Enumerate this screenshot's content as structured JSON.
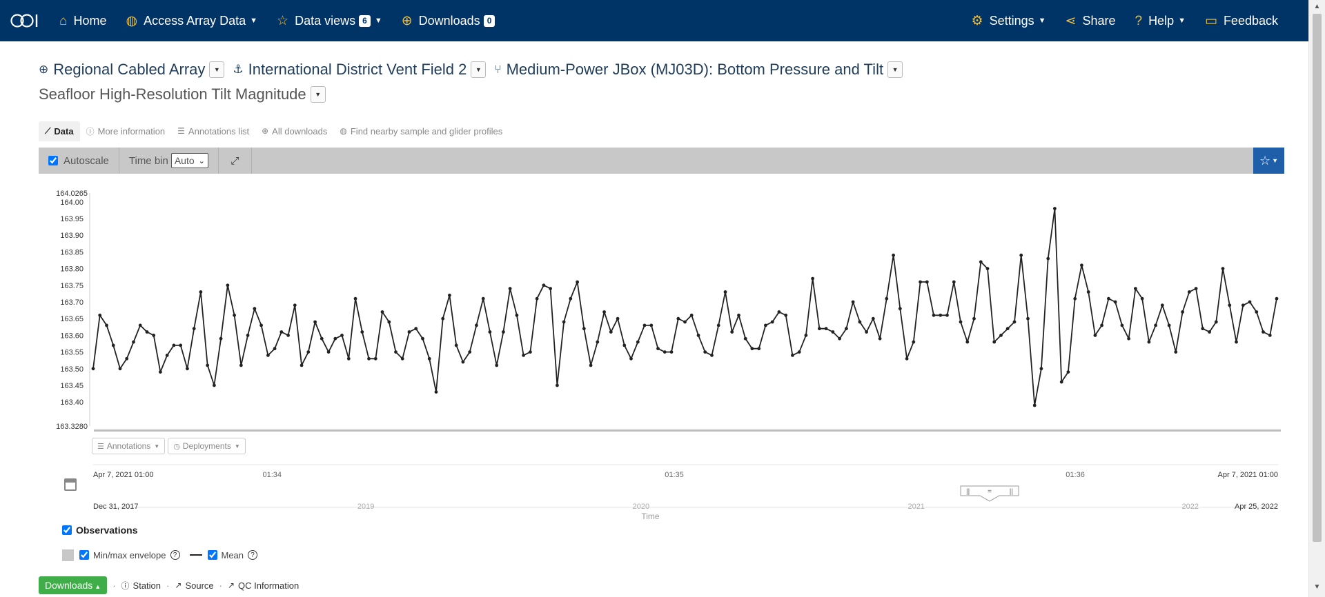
{
  "nav": {
    "home": "Home",
    "access": "Access Array Data",
    "views": "Data views",
    "views_count": "6",
    "downloads": "Downloads",
    "downloads_count": "0",
    "settings": "Settings",
    "share": "Share",
    "help": "Help",
    "feedback": "Feedback"
  },
  "crumbs": {
    "array": "Regional Cabled Array",
    "site": "International District Vent Field 2",
    "node": "Medium-Power JBox (MJ03D): Bottom Pressure and Tilt",
    "instrument": "Seafloor High-Resolution Tilt Magnitude"
  },
  "tabs": {
    "data": "Data",
    "more_info": "More information",
    "annotations": "Annotations list",
    "all_downloads": "All downloads",
    "nearby": "Find nearby sample and glider profiles"
  },
  "toolbar": {
    "autoscale": "Autoscale",
    "time_bin": "Time bin",
    "time_bin_value": "Auto"
  },
  "chips": {
    "annotations": "Annotations",
    "deployments": "Deployments"
  },
  "legend": {
    "observations": "Observations",
    "envelope": "Min/max envelope",
    "mean": "Mean"
  },
  "bottom": {
    "downloads": "Downloads",
    "station": "Station",
    "source": "Source",
    "qc": "QC Information"
  },
  "colors": {
    "navbar": "#003366",
    "nav_icon": "#f0c040",
    "series": "#222222",
    "downloads_button": "#3fae49",
    "fav_button": "#1f5ea8"
  },
  "chart_data": {
    "type": "line",
    "xlabel": "Time",
    "ylim": [
      163.328,
      164.0265
    ],
    "y_ticks": [
      "164.00",
      "163.95",
      "163.90",
      "163.85",
      "163.80",
      "163.75",
      "163.70",
      "163.65",
      "163.60",
      "163.55",
      "163.50",
      "163.45",
      "163.40"
    ],
    "y_extents": [
      "164.0265",
      "163.3280"
    ],
    "x_range_labels": [
      "Apr 7, 2021 01:00",
      "Apr 7, 2021 01:00"
    ],
    "x_ticks": [
      "01:34",
      "01:35",
      "01:36"
    ],
    "navigator_range_labels": [
      "Dec 31, 2017",
      "Apr 25, 2022"
    ],
    "navigator_ticks": [
      "2019",
      "2020",
      "2021",
      "2022"
    ],
    "series": [
      {
        "values": [
          163.5,
          163.66,
          163.63,
          163.57,
          163.5,
          163.53,
          163.58,
          163.63,
          163.61,
          163.6,
          163.49,
          163.54,
          163.57,
          163.57,
          163.5,
          163.62,
          163.73,
          163.51,
          163.45,
          163.59,
          163.75,
          163.66,
          163.51,
          163.6,
          163.68,
          163.63,
          163.54,
          163.56,
          163.61,
          163.6,
          163.69,
          163.51,
          163.55,
          163.64,
          163.59,
          163.55,
          163.59,
          163.6,
          163.53,
          163.71,
          163.61,
          163.53,
          163.53,
          163.67,
          163.64,
          163.55,
          163.53,
          163.61,
          163.62,
          163.59,
          163.53,
          163.43,
          163.65,
          163.72,
          163.57,
          163.52,
          163.55,
          163.63,
          163.71,
          163.61,
          163.51,
          163.61,
          163.74,
          163.66,
          163.54,
          163.55,
          163.71,
          163.75,
          163.74,
          163.45,
          163.64,
          163.71,
          163.76,
          163.62,
          163.51,
          163.58,
          163.67,
          163.61,
          163.65,
          163.57,
          163.53,
          163.58,
          163.63,
          163.63,
          163.56,
          163.55,
          163.55,
          163.65,
          163.64,
          163.66,
          163.6,
          163.55,
          163.54,
          163.63,
          163.73,
          163.61,
          163.66,
          163.59,
          163.56,
          163.56,
          163.63,
          163.64,
          163.67,
          163.66,
          163.54,
          163.55,
          163.6,
          163.77,
          163.62,
          163.62,
          163.61,
          163.59,
          163.62,
          163.7,
          163.64,
          163.61,
          163.65,
          163.59,
          163.71,
          163.84,
          163.68,
          163.53,
          163.58,
          163.76,
          163.76,
          163.66,
          163.66,
          163.66,
          163.76,
          163.64,
          163.58,
          163.65,
          163.82,
          163.8,
          163.58,
          163.6,
          163.62,
          163.64,
          163.84,
          163.65,
          163.39,
          163.5,
          163.83,
          163.98,
          163.46,
          163.49,
          163.71,
          163.81,
          163.73,
          163.6,
          163.63,
          163.71,
          163.7,
          163.63,
          163.59,
          163.74,
          163.71,
          163.58,
          163.63,
          163.69,
          163.63,
          163.55,
          163.67,
          163.73,
          163.74,
          163.62,
          163.61,
          163.64,
          163.8,
          163.69,
          163.58,
          163.69,
          163.7,
          163.67,
          163.61,
          163.6,
          163.71
        ]
      }
    ]
  }
}
